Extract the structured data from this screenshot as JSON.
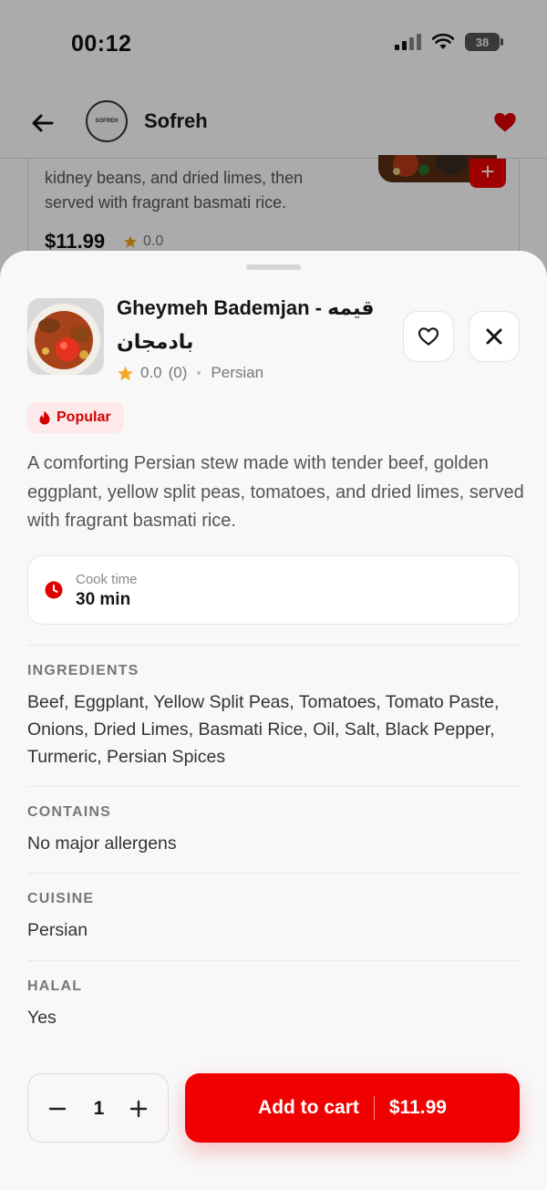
{
  "status_bar": {
    "time": "00:12",
    "battery": "38"
  },
  "header": {
    "title": "Sofreh",
    "logo_text": "SOFREH"
  },
  "background_card": {
    "description": "kidney beans, and dried limes, then served with fragrant basmati rice.",
    "price": "$11.99",
    "rating": "0.0",
    "add_label": "+"
  },
  "sheet": {
    "title": "Gheymeh Bademjan - قیمه بادمجان",
    "rating": "0.0",
    "rating_count": "(0)",
    "cuisine_tag": "Persian",
    "badge": "Popular",
    "description": "A comforting Persian stew made with tender beef, golden eggplant, yellow split peas, tomatoes, and dried limes, served with fragrant basmati rice.",
    "cook_time_label": "Cook time",
    "cook_time_value": "30 min",
    "sections": {
      "ingredients_label": "INGREDIENTS",
      "ingredients_value": "Beef, Eggplant, Yellow Split Peas, Tomatoes, Tomato Paste, Onions, Dried Limes, Basmati Rice, Oil, Salt, Black Pepper, Turmeric, Persian Spices",
      "contains_label": "CONTAINS",
      "contains_value": "No major allergens",
      "cuisine_label": "CUISINE",
      "cuisine_value": "Persian",
      "halal_label": "HALAL",
      "halal_value": "Yes"
    },
    "quantity": "1",
    "cart_label": "Add to cart",
    "cart_price": "$11.99"
  },
  "colors": {
    "accent": "#f00000",
    "star": "#f5a623",
    "badge_bg": "#fde9e9"
  },
  "icons": [
    "back-arrow-icon",
    "heart-icon",
    "star-icon",
    "close-icon",
    "flame-icon",
    "clock-icon",
    "minus-icon",
    "plus-icon"
  ]
}
